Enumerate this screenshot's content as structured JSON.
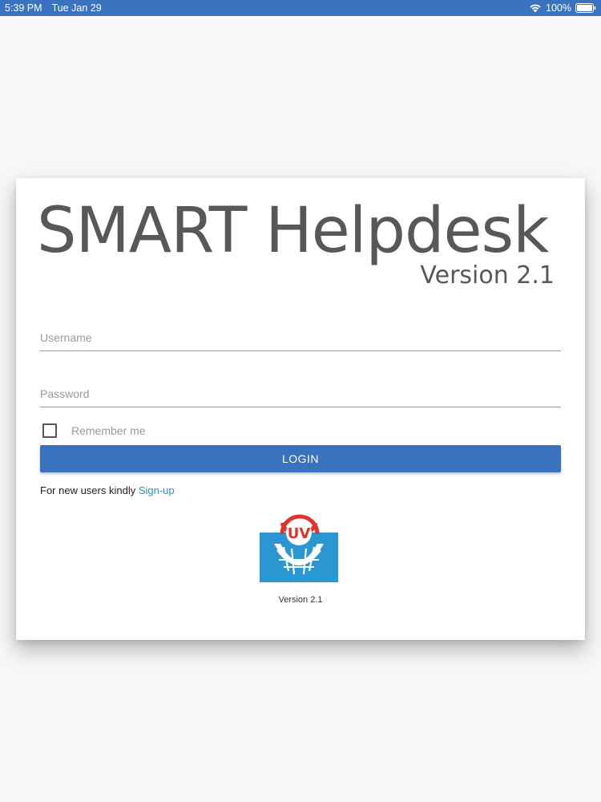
{
  "status_bar": {
    "time": "5:39 PM",
    "date": "Tue Jan 29",
    "battery": "100%",
    "icons": [
      "wifi-icon",
      "battery-icon"
    ]
  },
  "brand": {
    "title": "SMART Helpdesk",
    "version": "Version 2.1"
  },
  "form": {
    "username_placeholder": "Username",
    "username_value": "",
    "password_placeholder": "Password",
    "password_value": "",
    "remember_label": "Remember me",
    "remember_checked": false,
    "login_label": "LOGIN"
  },
  "signup": {
    "prefix": "For new users kindly ",
    "link_label": "Sign-up"
  },
  "logo": {
    "text": "UV",
    "icon": "uv-logo-icon"
  },
  "footer": {
    "version": "Version 2.1"
  },
  "colors": {
    "accent": "#3a73bd",
    "link": "#2a8fc8",
    "brand_text": "#58585a",
    "logo_red": "#e0332c",
    "logo_blue": "#2a96d2"
  }
}
